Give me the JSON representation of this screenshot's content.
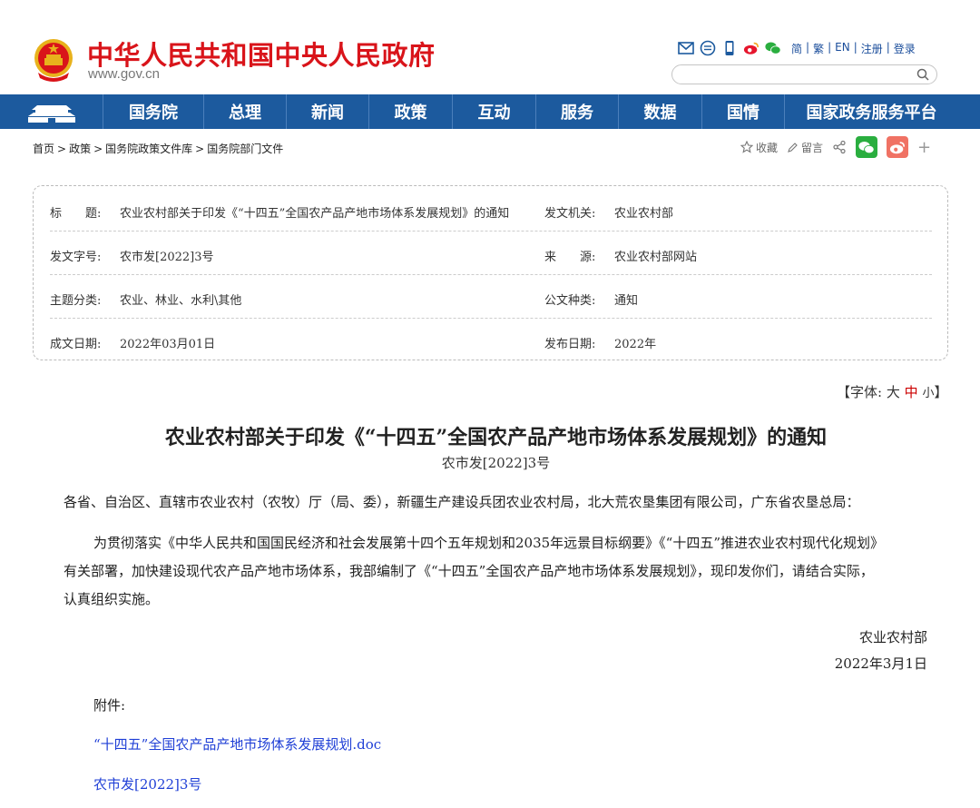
{
  "site": {
    "title": "中华人民共和国中央人民政府",
    "url": "www.gov.cn"
  },
  "header_links": [
    "简",
    "繁",
    "EN",
    "注册",
    "登录"
  ],
  "header_icons": [
    "mail-icon",
    "chat-icon",
    "mobile-icon",
    "weibo-icon",
    "wechat-icon"
  ],
  "nav": [
    "国务院",
    "总理",
    "新闻",
    "政策",
    "互动",
    "服务",
    "数据",
    "国情",
    "国家政务服务平台"
  ],
  "breadcrumb": [
    "首页",
    "政策",
    "国务院政策文件库",
    "国务院部门文件"
  ],
  "share": {
    "favorite": "收藏",
    "comment": "留言"
  },
  "info": {
    "title_label": "标　　题:",
    "title_value": "农业农村部关于印发《“十四五”全国农产品产地市场体系发展规划》的通知",
    "issuer_label": "发文机关:",
    "issuer_value": "农业农村部",
    "docno_label": "发文字号:",
    "docno_value": "农市发[2022]3号",
    "source_label": "来　　源:",
    "source_value": "农业农村部网站",
    "topic_label": "主题分类:",
    "topic_value": "农业、林业、水利\\其他",
    "type_label": "公文种类:",
    "type_value": "通知",
    "created_label": "成文日期:",
    "created_value": "2022年03月01日",
    "published_label": "发布日期:",
    "published_value": "2022年"
  },
  "font_switch": {
    "prefix": "【字体:",
    "large": "大",
    "medium": "中",
    "small": "小",
    "suffix": "】"
  },
  "article": {
    "title": "农业农村部关于印发《“十四五”全国农产品产地市场体系发展规划》的通知",
    "doc_no": "农市发[2022]3号",
    "addressee": "各省、自治区、直辖市农业农村（农牧）厅（局、委），新疆生产建设兵团农业农村局，北大荒农垦集团有限公司，广东省农垦总局：",
    "body_line1": "为贯彻落实《中华人民共和国国民经济和社会发展第十四个五年规划和2035年远景目标纲要》《“十四五”推进农业农村现代化规划》",
    "body_line2": "有关部署，加快建设现代农产品产地市场体系，我部编制了《“十四五”全国农产品产地市场体系发展规划》，现印发你们，请结合实际，",
    "body_line3": "认真组织实施。",
    "signer": "农业农村部",
    "date": "2022年3月1日",
    "attachment_label": "附件:",
    "attachments": [
      "“十四五”全国农产品产地市场体系发展规划.doc",
      "农市发[2022]3号"
    ]
  },
  "colors": {
    "brand_red": "#d9141a",
    "nav_blue": "#1c5a9e",
    "link_blue": "#1f3fd6"
  }
}
